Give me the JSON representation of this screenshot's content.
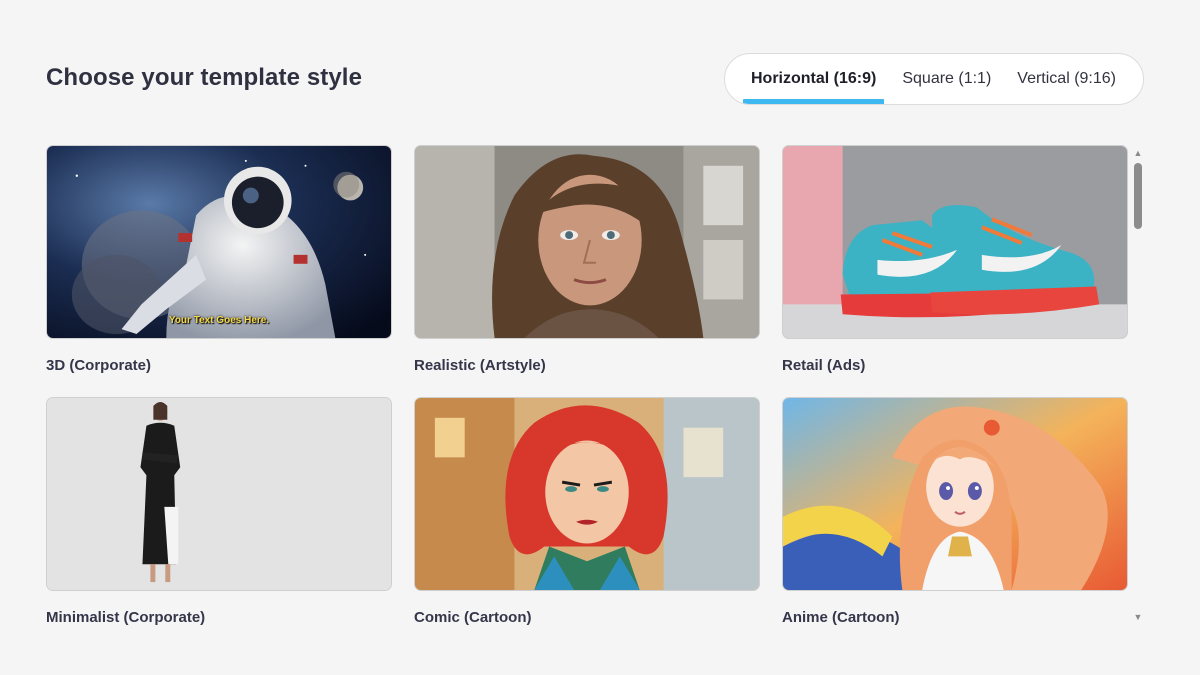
{
  "header": {
    "title": "Choose your template style"
  },
  "tabs": [
    {
      "label": "Horizontal (16:9)",
      "active": true
    },
    {
      "label": "Square (1:1)",
      "active": false
    },
    {
      "label": "Vertical (9:16)",
      "active": false
    }
  ],
  "templates": [
    {
      "label": "3D (Corporate)",
      "overlay": "Your Text Goes Here."
    },
    {
      "label": "Realistic (Artstyle)"
    },
    {
      "label": "Retail (Ads)"
    },
    {
      "label": "Minimalist (Corporate)"
    },
    {
      "label": "Comic (Cartoon)"
    },
    {
      "label": "Anime (Cartoon)"
    }
  ],
  "colors": {
    "accent": "#3db8f0",
    "background": "#f5f5f5",
    "title": "#2f3140"
  }
}
